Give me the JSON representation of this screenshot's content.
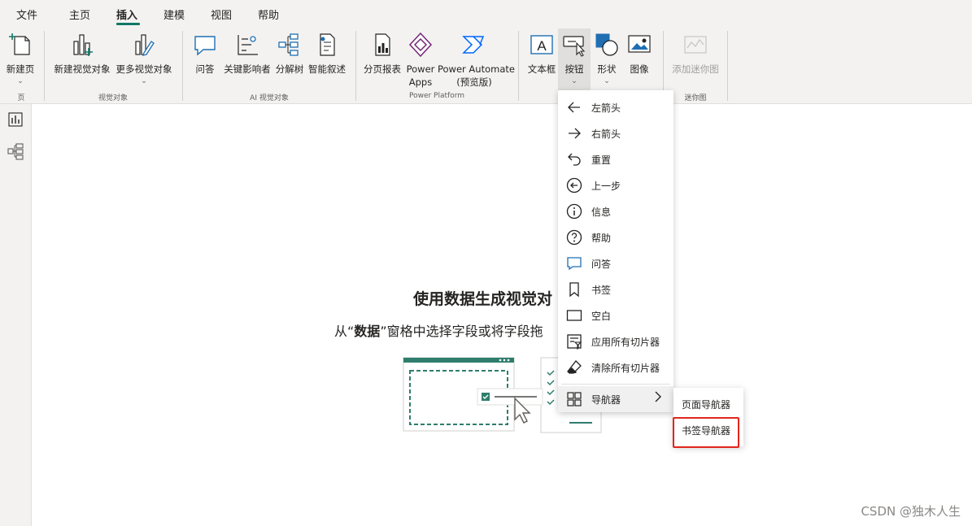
{
  "menu": {
    "items": [
      {
        "label": "文件"
      },
      {
        "label": "主页"
      },
      {
        "label": "插入",
        "active": true
      },
      {
        "label": "建模"
      },
      {
        "label": "视图"
      },
      {
        "label": "帮助"
      }
    ]
  },
  "ribbon": {
    "new_page": "新建页",
    "new_visual": "新建视觉对象",
    "more_visuals": "更多视觉对象",
    "qa": "问答",
    "key_influencers": "关键影响者",
    "decomposition_tree": "分解树",
    "smart_narrative": "智能叙述",
    "paginated_report": "分页报表",
    "power_apps_1": "Power",
    "power_apps_2": "Apps",
    "power_automate_1": "Power Automate",
    "power_automate_2": "(预览版)",
    "text_box": "文本框",
    "buttons": "按钮",
    "shapes": "形状",
    "image": "图像",
    "sparkline": "添加迷你图",
    "groups": {
      "page": "页",
      "visuals": "视觉对象",
      "ai_visuals": "AI 视觉对象",
      "power_platform": "Power Platform",
      "sparklines": "迷你图"
    }
  },
  "canvas": {
    "title": "使用数据生成视觉对",
    "sub_prefix": "从“",
    "sub_bold": "数据",
    "sub_suffix": "”窗格中选择字段或将字段拖"
  },
  "dropdown": {
    "items": [
      {
        "label": "左箭头",
        "icon": "left-arrow-icon"
      },
      {
        "label": "右箭头",
        "icon": "right-arrow-icon"
      },
      {
        "label": "重置",
        "icon": "reset-icon"
      },
      {
        "label": "上一步",
        "icon": "back-circle-icon"
      },
      {
        "label": "信息",
        "icon": "info-icon"
      },
      {
        "label": "帮助",
        "icon": "help-icon"
      },
      {
        "label": "问答",
        "icon": "qa-bubble-icon"
      },
      {
        "label": "书签",
        "icon": "bookmark-icon"
      },
      {
        "label": "空白",
        "icon": "blank-icon"
      },
      {
        "label": "应用所有切片器",
        "icon": "apply-slicers-icon"
      },
      {
        "label": "清除所有切片器",
        "icon": "eraser-icon"
      }
    ],
    "navigator": "导航器",
    "navigator_arrow": "›"
  },
  "submenu": {
    "page_navigator": "页面导航器",
    "bookmark_navigator": "书签导航器"
  },
  "watermark": "CSDN @独木人生",
  "colors": {
    "accent": "#117865",
    "highlight_box": "#e0261b",
    "icon_blue": "#1f6fb2"
  }
}
